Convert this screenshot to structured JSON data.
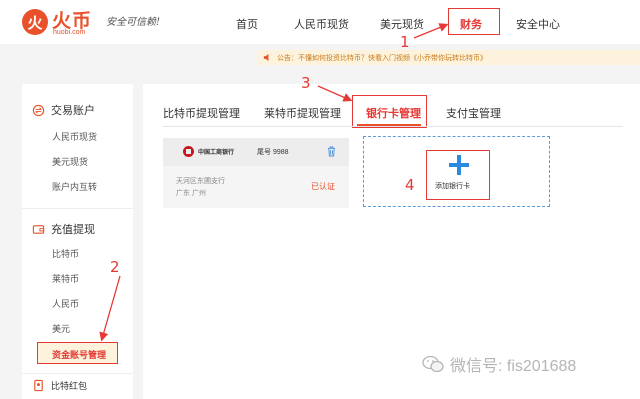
{
  "header": {
    "logo_mark": "火",
    "logo_name": "火币",
    "logo_domain": "huobi.com",
    "slogan": "安全可信赖!",
    "nav": [
      {
        "label": "首页"
      },
      {
        "label": "人民币现货"
      },
      {
        "label": "美元现货"
      },
      {
        "label": "财务"
      },
      {
        "label": "安全中心"
      }
    ]
  },
  "notice": {
    "text": "公告：不懂如何投资比特币？快看入门视频《小乔带你玩转比特币》"
  },
  "sidebar": {
    "section1": {
      "title": "交易账户",
      "items": [
        "人民币现货",
        "美元现货",
        "账户内互转"
      ]
    },
    "section2": {
      "title": "充值提现",
      "items": [
        "比特币",
        "莱特币",
        "人民币",
        "美元",
        "资金账号管理"
      ]
    },
    "section3": {
      "title": "比特红包"
    }
  },
  "tabs": [
    "比特币提现管理",
    "莱特币提现管理",
    "银行卡管理",
    "支付宝管理"
  ],
  "card": {
    "bank_name": "中国工商银行",
    "tail": "尾号 9988",
    "branch": "天河区东圃支行",
    "region": "广东 广州",
    "status": "已认证"
  },
  "add_card": {
    "label": "添加银行卡"
  },
  "annotations": [
    "1",
    "2",
    "3",
    "4"
  ],
  "watermark": {
    "text": "微信号: fis201688"
  },
  "colors": {
    "brand": "#e9512a",
    "annotation": "#e53935",
    "accent_blue": "#2a8be0"
  }
}
